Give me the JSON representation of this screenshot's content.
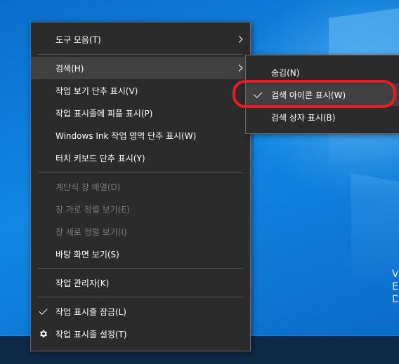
{
  "context_menu": {
    "items": [
      {
        "label": "도구 모음(T)"
      },
      {
        "label": "검색(H)"
      },
      {
        "label": "작업 보기 단추 표시(V)"
      },
      {
        "label": "작업 표시줄에 피플 표시(P)"
      },
      {
        "label": "Windows Ink 작업 영역 단추 표시(W)"
      },
      {
        "label": "터치 키보드 단추 표시(Y)"
      },
      {
        "label": "계단식 창 배열(D)"
      },
      {
        "label": "창 가로 정렬 보기(E)"
      },
      {
        "label": "창 세로 정렬 보기(I)"
      },
      {
        "label": "바탕 화면 보기(S)"
      },
      {
        "label": "작업 관리자(K)"
      },
      {
        "label": "작업 표시줄 잠금(L)"
      },
      {
        "label": "작업 표시줄 설정(T)"
      }
    ]
  },
  "search_submenu": {
    "items": [
      {
        "label": "숨김(N)"
      },
      {
        "label": "검색 아이콘 표시(W)"
      },
      {
        "label": "검색 상자 표시(B)"
      }
    ]
  },
  "desktop": {
    "right_edge_text": "V\nE\nD"
  },
  "colors": {
    "menu_background": "#2b2b2b",
    "menu_hover": "#414141",
    "menu_border": "#6b6b6b",
    "separator": "#5a5a5a",
    "disabled_text": "#7a7a7a",
    "highlight_ring": "#ec1c24",
    "desktop_blue": "#0f7bd6",
    "taskbar": "#0e2a47"
  },
  "icons": {
    "submenu_arrow": "chevron-right-icon",
    "checked": "checkmark-icon",
    "settings": "gear-icon"
  },
  "state": {
    "hovered_main_item": "검색(H)",
    "hovered_sub_item": "검색 아이콘 표시(W)",
    "checked_items": [
      "검색 아이콘 표시(W)",
      "작업 표시줄 잠금(L)"
    ],
    "disabled_items": [
      "계단식 창 배열(D)",
      "창 가로 정렬 보기(E)",
      "창 세로 정렬 보기(I)"
    ]
  }
}
